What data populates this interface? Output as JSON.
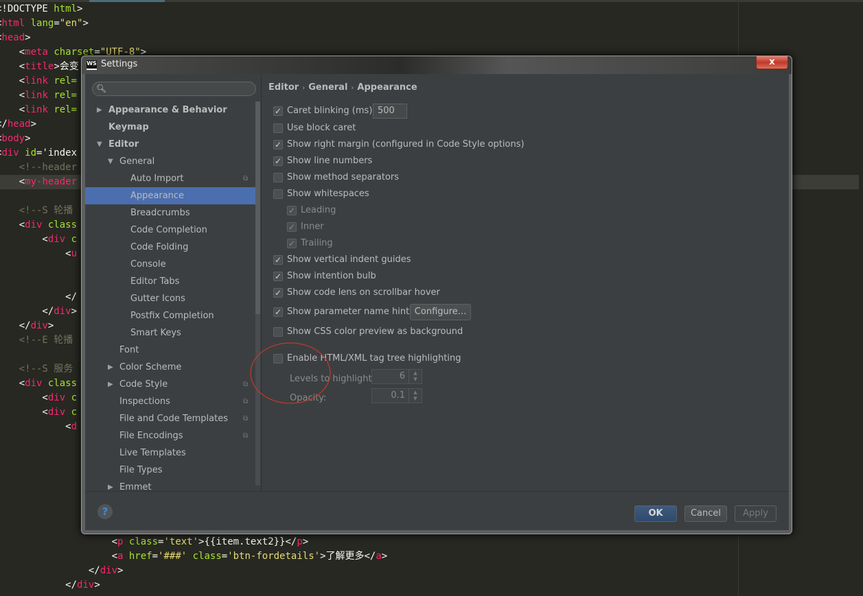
{
  "editor": {
    "lines": [
      [
        [
          "p",
          "<!DOCTYPE "
        ],
        [
          "a",
          "html"
        ],
        [
          "p",
          ">"
        ]
      ],
      [
        [
          "p",
          "<"
        ],
        [
          "t",
          "html "
        ],
        [
          "a",
          "lang"
        ],
        [
          "p",
          "="
        ],
        [
          "s",
          "\"en\""
        ],
        [
          "p",
          ">"
        ]
      ],
      [
        [
          "p",
          "<"
        ],
        [
          "t",
          "head"
        ],
        [
          "p",
          ">"
        ]
      ],
      [
        [
          "p",
          "    <"
        ],
        [
          "t",
          "meta "
        ],
        [
          "a",
          "charset"
        ],
        [
          "p",
          "="
        ],
        [
          "s",
          "\"UTF-8\""
        ],
        [
          "p",
          ">"
        ]
      ],
      [
        [
          "p",
          "    <"
        ],
        [
          "t",
          "title"
        ],
        [
          "p",
          ">会变"
        ]
      ],
      [
        [
          "p",
          "    <"
        ],
        [
          "t",
          "link "
        ],
        [
          "a",
          "rel="
        ]
      ],
      [
        [
          "p",
          "    <"
        ],
        [
          "t",
          "link "
        ],
        [
          "a",
          "rel="
        ]
      ],
      [
        [
          "p",
          "    <"
        ],
        [
          "t",
          "link "
        ],
        [
          "a",
          "rel="
        ]
      ],
      [
        [
          "p",
          "</"
        ],
        [
          "t",
          "head"
        ],
        [
          "p",
          ">"
        ]
      ],
      [
        [
          "p",
          "<"
        ],
        [
          "t",
          "body"
        ],
        [
          "p",
          ">"
        ]
      ],
      [
        [
          "p",
          "<"
        ],
        [
          "t",
          "div "
        ],
        [
          "a",
          "id"
        ],
        [
          "p",
          "='index"
        ]
      ],
      [
        [
          "c",
          "    <!--header"
        ]
      ],
      [
        [
          "p",
          "    <"
        ],
        [
          "t",
          "my-header"
        ]
      ],
      [],
      [
        [
          "c",
          "    <!--S 轮播"
        ]
      ],
      [
        [
          "p",
          "    <"
        ],
        [
          "t",
          "div "
        ],
        [
          "a",
          "class"
        ]
      ],
      [
        [
          "p",
          "        <"
        ],
        [
          "t",
          "div "
        ],
        [
          "a",
          "c"
        ]
      ],
      [
        [
          "p",
          "            <"
        ],
        [
          "t",
          "u"
        ]
      ],
      [],
      [],
      [
        [
          "p",
          "            </"
        ]
      ],
      [
        [
          "p",
          "        </"
        ],
        [
          "t",
          "div"
        ],
        [
          "p",
          ">"
        ]
      ],
      [
        [
          "p",
          "    </"
        ],
        [
          "t",
          "div"
        ],
        [
          "p",
          ">"
        ]
      ],
      [
        [
          "c",
          "    <!--E 轮播"
        ]
      ],
      [],
      [
        [
          "c",
          "    <!--S 服务"
        ]
      ],
      [
        [
          "p",
          "    <"
        ],
        [
          "t",
          "div "
        ],
        [
          "a",
          "class"
        ]
      ],
      [
        [
          "p",
          "        <"
        ],
        [
          "t",
          "div "
        ],
        [
          "a",
          "c"
        ]
      ],
      [
        [
          "p",
          "        <"
        ],
        [
          "t",
          "div "
        ],
        [
          "a",
          "c"
        ]
      ],
      [
        [
          "p",
          "            <"
        ],
        [
          "t",
          "d"
        ]
      ],
      [],
      [],
      [],
      [],
      [],
      [],
      [],
      [
        [
          "p",
          "                    <"
        ],
        [
          "t",
          "p "
        ],
        [
          "a",
          "class"
        ],
        [
          "p",
          "="
        ],
        [
          "s",
          "'text'"
        ],
        [
          "p",
          ">{{item.text2}}</"
        ],
        [
          "t",
          "p"
        ],
        [
          "p",
          ">"
        ]
      ],
      [
        [
          "p",
          "                    <"
        ],
        [
          "t",
          "a "
        ],
        [
          "a",
          "href"
        ],
        [
          "p",
          "="
        ],
        [
          "s",
          "'###' "
        ],
        [
          "a",
          "class"
        ],
        [
          "p",
          "="
        ],
        [
          "s",
          "'btn-fordetails'"
        ],
        [
          "p",
          ">了解更多</"
        ],
        [
          "t",
          "a"
        ],
        [
          "p",
          ">"
        ]
      ],
      [
        [
          "p",
          "                </"
        ],
        [
          "t",
          "div"
        ],
        [
          "p",
          ">"
        ]
      ],
      [
        [
          "p",
          "            </"
        ],
        [
          "t",
          "div"
        ],
        [
          "p",
          ">"
        ]
      ]
    ]
  },
  "dialog": {
    "title": "Settings",
    "app_icon": "WS",
    "close_label": "x",
    "search": {
      "placeholder": "",
      "value": ""
    },
    "sidebar": [
      {
        "label": "Appearance & Behavior",
        "level": 0,
        "arrow": "right",
        "bold": true
      },
      {
        "label": "Keymap",
        "level": 0,
        "bold": true
      },
      {
        "label": "Editor",
        "level": 0,
        "arrow": "down",
        "bold": true
      },
      {
        "label": "General",
        "level": 1,
        "arrow": "down"
      },
      {
        "label": "Auto Import",
        "level": 2,
        "copy": true
      },
      {
        "label": "Appearance",
        "level": 2,
        "selected": true
      },
      {
        "label": "Breadcrumbs",
        "level": 2
      },
      {
        "label": "Code Completion",
        "level": 2
      },
      {
        "label": "Code Folding",
        "level": 2
      },
      {
        "label": "Console",
        "level": 2
      },
      {
        "label": "Editor Tabs",
        "level": 2
      },
      {
        "label": "Gutter Icons",
        "level": 2
      },
      {
        "label": "Postfix Completion",
        "level": 2
      },
      {
        "label": "Smart Keys",
        "level": 2
      },
      {
        "label": "Font",
        "level": 1
      },
      {
        "label": "Color Scheme",
        "level": 1,
        "arrow": "right"
      },
      {
        "label": "Code Style",
        "level": 1,
        "arrow": "right",
        "copy": true
      },
      {
        "label": "Inspections",
        "level": 1,
        "copy": true
      },
      {
        "label": "File and Code Templates",
        "level": 1,
        "copy": true
      },
      {
        "label": "File Encodings",
        "level": 1,
        "copy": true
      },
      {
        "label": "Live Templates",
        "level": 1
      },
      {
        "label": "File Types",
        "level": 1
      },
      {
        "label": "Emmet",
        "level": 1,
        "arrow": "right"
      }
    ],
    "breadcrumb": [
      "Editor",
      "General",
      "Appearance"
    ],
    "breadcrumb_sep": "›",
    "options": [
      {
        "label": "Caret blinking (ms):",
        "checked": true,
        "field": "500"
      },
      {
        "label": "Use block caret",
        "checked": false
      },
      {
        "label": "Show right margin (configured in Code Style options)",
        "checked": true
      },
      {
        "label": "Show line numbers",
        "checked": true
      },
      {
        "label": "Show method separators",
        "checked": false
      },
      {
        "label": "Show whitespaces",
        "checked": false
      },
      {
        "label": "Leading",
        "checked": true,
        "disabled": true,
        "indent": true
      },
      {
        "label": "Inner",
        "checked": true,
        "disabled": true,
        "indent": true
      },
      {
        "label": "Trailing",
        "checked": true,
        "disabled": true,
        "indent": true
      },
      {
        "label": "Show vertical indent guides",
        "checked": true
      },
      {
        "label": "Show intention bulb",
        "checked": true
      },
      {
        "label": "Show code lens on scrollbar hover",
        "checked": true
      },
      {
        "label": "Show parameter name hints",
        "checked": true,
        "button": "Configure..."
      },
      {
        "label": "Show CSS color preview as background",
        "checked": false
      },
      {
        "label": "Enable HTML/XML tag tree highlighting",
        "checked": false
      }
    ],
    "levels_label": "Levels to highlight:",
    "levels_value": "6",
    "opacity_label": "Opacity:",
    "opacity_value": "0.1",
    "help_label": "?",
    "ok_label": "OK",
    "cancel_label": "Cancel",
    "apply_label": "Apply",
    "annotation_color": "#c0392b",
    "accent_color": "#4b6eaf"
  }
}
